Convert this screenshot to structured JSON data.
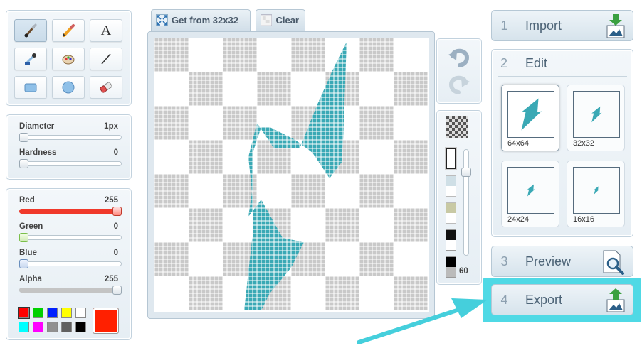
{
  "tools": [
    {
      "name": "brush-tool",
      "icon": "brush-icon",
      "active": true
    },
    {
      "name": "pencil-tool",
      "icon": "pencil-icon",
      "active": false
    },
    {
      "name": "text-tool",
      "icon": "text-icon",
      "glyph": "A",
      "active": false
    },
    {
      "name": "eyedropper-tool",
      "icon": "eyedropper-icon",
      "active": false
    },
    {
      "name": "bucket-tool",
      "icon": "paint-bucket-icon",
      "active": false
    },
    {
      "name": "line-tool",
      "icon": "line-icon",
      "active": false
    },
    {
      "name": "rectangle-tool",
      "icon": "rectangle-icon",
      "active": false
    },
    {
      "name": "ellipse-tool",
      "icon": "ellipse-icon",
      "active": false
    },
    {
      "name": "eraser-tool",
      "icon": "eraser-icon",
      "active": false
    }
  ],
  "brush": {
    "diameter_label": "Diameter",
    "diameter_value": "1px",
    "diameter_fraction": 0,
    "hardness_label": "Hardness",
    "hardness_value": "0",
    "hardness_fraction": 0
  },
  "color": {
    "red_label": "Red",
    "red_value": "255",
    "red_fraction": 1,
    "green_label": "Green",
    "green_value": "0",
    "green_fraction": 0,
    "blue_label": "Blue",
    "blue_value": "0",
    "blue_fraction": 0,
    "alpha_label": "Alpha",
    "alpha_value": "255",
    "alpha_fraction": 1,
    "current": "#ff2000",
    "palette": [
      "#ff0000",
      "#00d000",
      "#0020ff",
      "#ffff00",
      "#ffffff",
      "#00ffff",
      "#ff00ff",
      "#909090",
      "#606060",
      "#000000"
    ]
  },
  "tabs": {
    "get_label": "Get from 32x32",
    "clear_label": "Clear"
  },
  "undo_icon": "undo-icon",
  "redo_icon": "redo-icon",
  "background": {
    "options": [
      "transparent",
      "#ffffff",
      "#cfdfe6",
      "#c8c9a4",
      "#000000",
      "#000000"
    ],
    "opacity_value": "60",
    "opacity_fraction": 0.82
  },
  "steps": [
    {
      "num": "1",
      "label": "Import",
      "icon": "import-icon"
    },
    {
      "num": "2",
      "label": "Edit"
    },
    {
      "num": "3",
      "label": "Preview",
      "icon": "preview-magnifier-icon"
    },
    {
      "num": "4",
      "label": "Export",
      "icon": "export-icon"
    }
  ],
  "sizes": [
    {
      "label": "64x64",
      "selected": true
    },
    {
      "label": "32x32",
      "selected": false
    },
    {
      "label": "24x24",
      "selected": false
    },
    {
      "label": "16x16",
      "selected": false
    }
  ],
  "colors": {
    "icon_teal": "#3aa9b5",
    "highlight": "#4fd9e5",
    "red_fill": "#ff2a1a"
  }
}
